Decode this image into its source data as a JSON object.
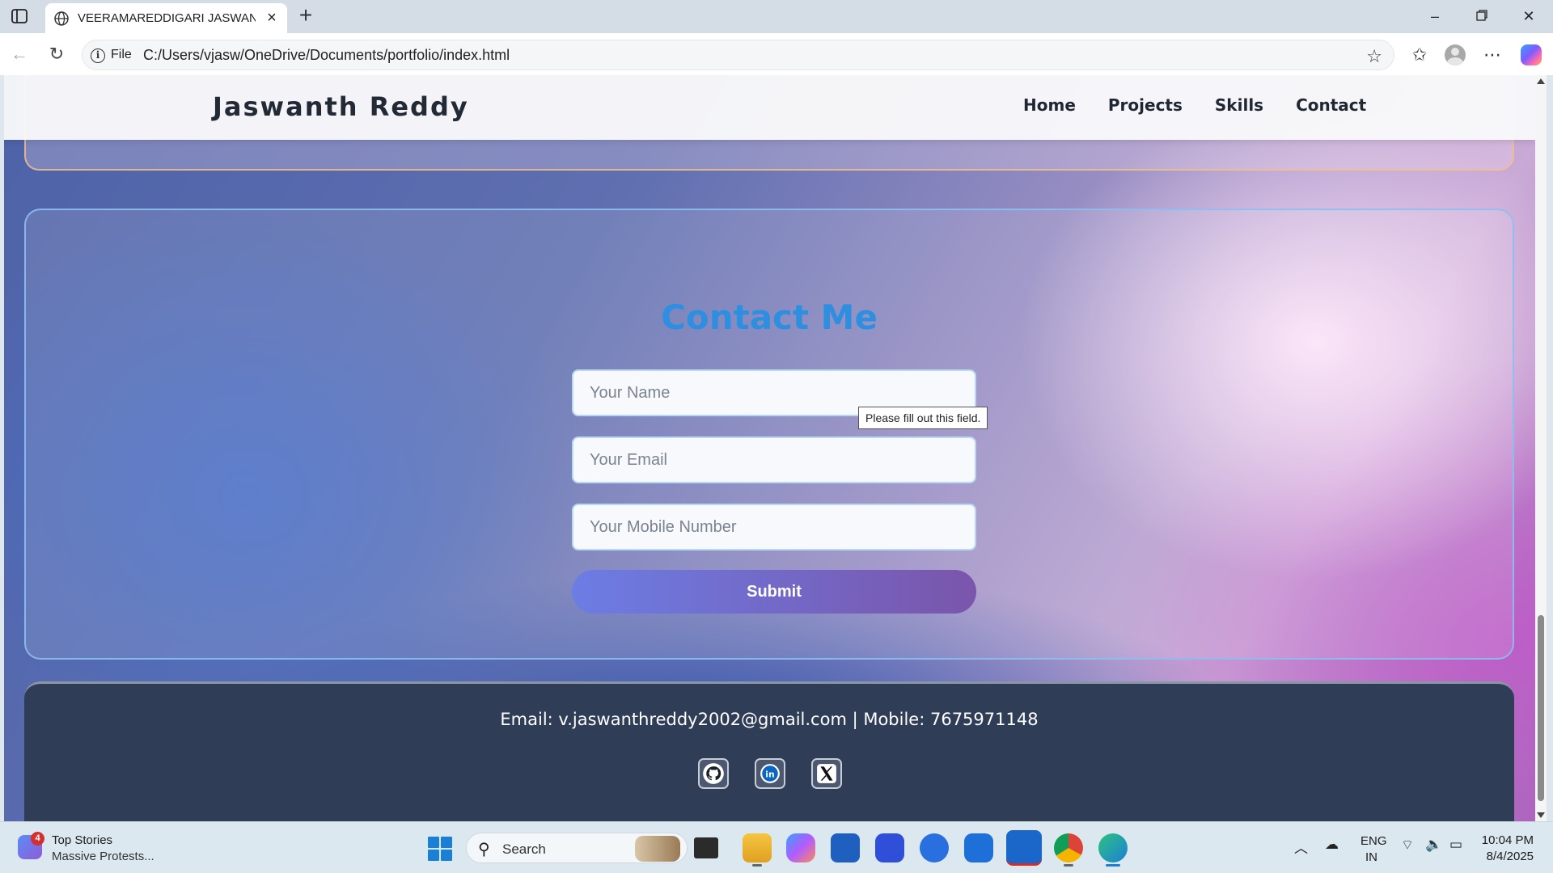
{
  "browser": {
    "tab_title": "VEERAMAREDDIGARI JASWANTH REDDY",
    "file_chip": "File",
    "url": "C:/Users/vjasw/OneDrive/Documents/portfolio/index.html"
  },
  "site": {
    "brand": "Jaswanth Reddy",
    "nav": [
      "Home",
      "Projects",
      "Skills",
      "Contact"
    ]
  },
  "contact": {
    "title": "Contact Me",
    "name_placeholder": "Your Name",
    "email_placeholder": "Your Email",
    "mobile_placeholder": "Your Mobile Number",
    "submit_label": "Submit",
    "validation_tooltip": "Please fill out this field."
  },
  "footer": {
    "contact_line": "Email: v.jaswanthreddy2002@gmail.com | Mobile: 7675971148",
    "social": [
      "github-icon",
      "linkedin-icon",
      "x-icon"
    ]
  },
  "taskbar": {
    "news_badge": "4",
    "news_title": "Top Stories",
    "news_subtitle": "Massive Protests...",
    "search_label": "Search",
    "lang_line1": "ENG",
    "lang_line2": "IN",
    "time": "10:04 PM",
    "date": "8/4/2025"
  },
  "colors": {
    "accent_title": "#2e8fe0",
    "submit_gradient_start": "#6c7de4",
    "submit_gradient_end": "#7a55ab",
    "footer_bg": "#2f3d57"
  }
}
